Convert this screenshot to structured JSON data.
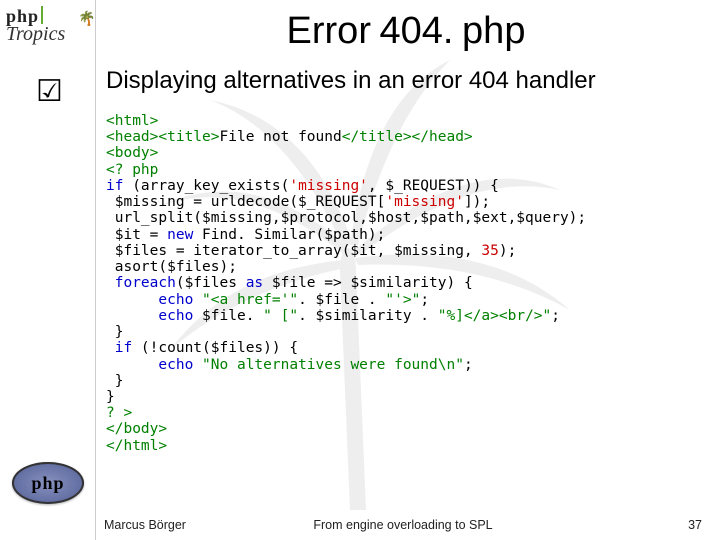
{
  "branding": {
    "php": "php",
    "tropics": "Tropics"
  },
  "title": "Error 404. php",
  "subtitle": "Displaying alternatives in an error 404 handler",
  "code": {
    "l1a": "<html>",
    "l2a": "<head><title>",
    "l2b": "File not found",
    "l2c": "</title></head>",
    "l3a": "<body>",
    "l4a": "<? php",
    "l5a": "if",
    "l5b": " (array_key_exists(",
    "l5c": "'missing'",
    "l5d": ", $_REQUEST)) {",
    "l6a": " $missing = urldecode($_REQUEST[",
    "l6b": "'missing'",
    "l6c": "]);",
    "l7a": " url_split($missing,$protocol,$host,$path,$ext,$query);",
    "l8a": " $it = ",
    "l8b": "new",
    "l8c": " Find. Similar($path);",
    "l9a": " $files = iterator_to_array($it, $missing, ",
    "l9b": "35",
    "l9c": ");",
    "l10a": " asort($files);",
    "l11a": " ",
    "l11b": "foreach",
    "l11c": "($files ",
    "l11d": "as",
    "l11e": " $file => $similarity) {",
    "l12a": "      ",
    "l12b": "echo",
    "l12c": " ",
    "l12d": "\"<a href='\"",
    "l12e": ". $file . ",
    "l12f": "\"'>\"",
    "l12g": ";",
    "l13a": "      ",
    "l13b": "echo",
    "l13c": " $file. ",
    "l13d": "\" [\"",
    "l13e": ". $similarity . ",
    "l13f": "\"%]</a><br/>\"",
    "l13g": ";",
    "l14a": " }",
    "l15a": " ",
    "l15b": "if",
    "l15c": " (!count($files)) {",
    "l16a": "      ",
    "l16b": "echo",
    "l16c": " ",
    "l16d": "\"No alternatives were found\\n\"",
    "l16e": ";",
    "l17a": " }",
    "l18a": "}",
    "l19a": "? >",
    "l20a": "</body>",
    "l21a": "</html>"
  },
  "footer": {
    "author": "Marcus Börger",
    "mid": "From engine overloading to SPL",
    "page": "37"
  },
  "phplogo": "php"
}
